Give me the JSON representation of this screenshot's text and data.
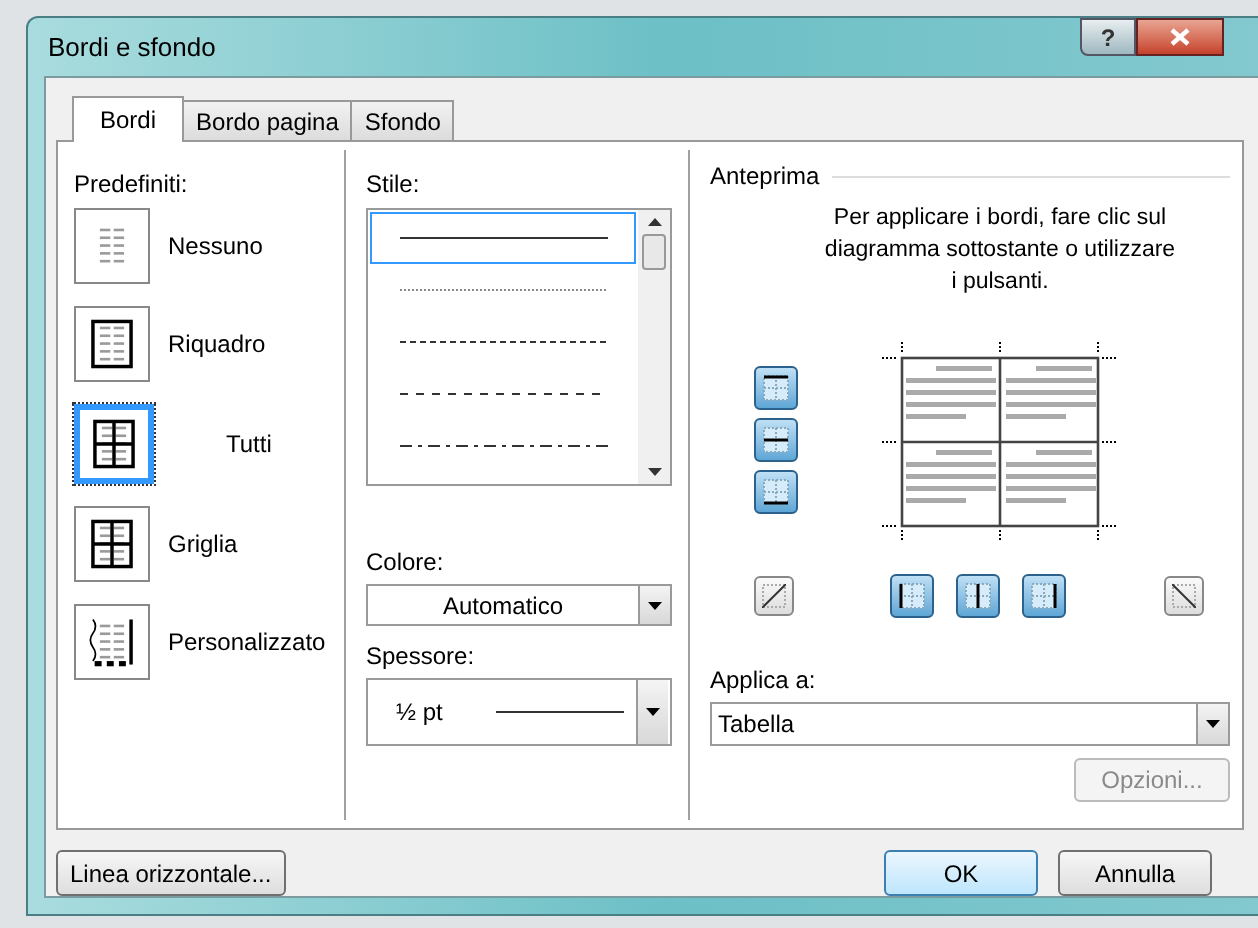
{
  "window": {
    "title": "Bordi e sfondo",
    "help_button": "?"
  },
  "tabs": [
    {
      "label": "Bordi",
      "selected": true
    },
    {
      "label": "Bordo pagina",
      "selected": false
    },
    {
      "label": "Sfondo",
      "selected": false
    }
  ],
  "presets": {
    "label": "Predefiniti:",
    "items": [
      {
        "kind": "none",
        "label": "Nessuno",
        "selected": false
      },
      {
        "kind": "box",
        "label": "Riquadro",
        "selected": false
      },
      {
        "kind": "all",
        "label": "Tutti",
        "selected": true
      },
      {
        "kind": "grid",
        "label": "Griglia",
        "selected": false
      },
      {
        "kind": "custom",
        "label": "Personalizzato",
        "selected": false
      }
    ]
  },
  "style": {
    "label": "Stile:",
    "items": [
      {
        "kind": "solid",
        "selected": true
      },
      {
        "kind": "dotted",
        "selected": false
      },
      {
        "kind": "dashed",
        "selected": false
      },
      {
        "kind": "longdash",
        "selected": false
      },
      {
        "kind": "dashdot",
        "selected": false
      }
    ]
  },
  "color": {
    "label": "Colore:",
    "value": "Automatico"
  },
  "weight": {
    "label": "Spessore:",
    "value": "½ pt"
  },
  "preview": {
    "label": "Anteprima",
    "instructions": "Per applicare i bordi, fare clic sul diagramma sottostante o utilizzare i pulsanti."
  },
  "apply_to": {
    "label": "Applica a:",
    "value": "Tabella"
  },
  "options_button": {
    "label": "Opzioni...",
    "disabled": true
  },
  "footer": {
    "horizontal_line_button": "Linea orizzontale...",
    "ok": "OK",
    "cancel": "Annulla"
  }
}
